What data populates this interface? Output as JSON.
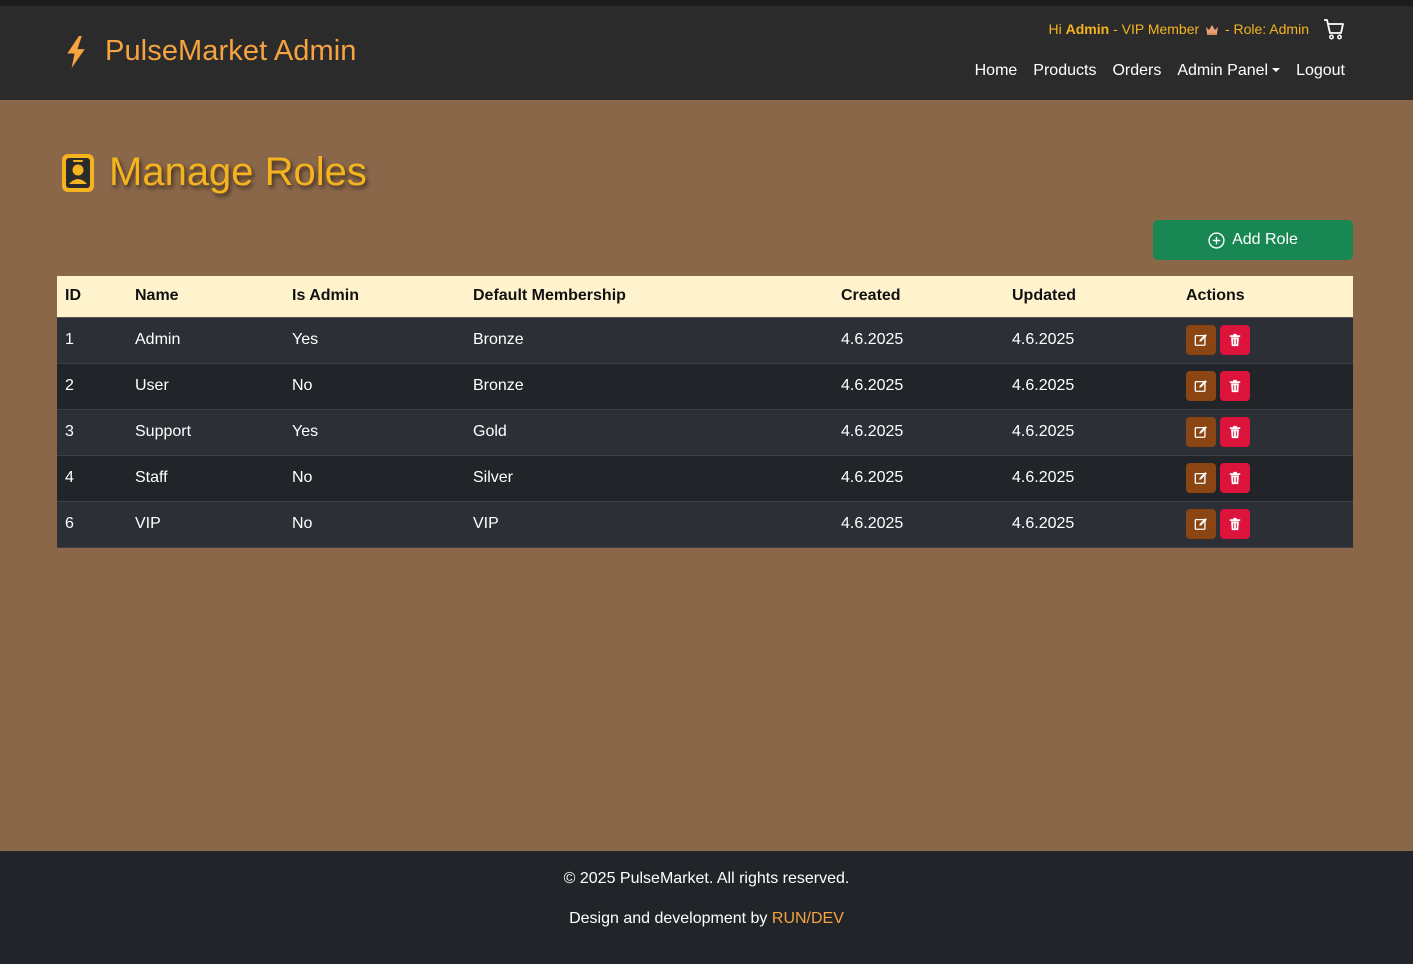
{
  "brand": {
    "name": "PulseMarket Admin"
  },
  "user": {
    "greeting": "Hi",
    "name": "Admin",
    "membership": "- VIP Member",
    "role": "- Role: Admin"
  },
  "nav": {
    "home": "Home",
    "products": "Products",
    "orders": "Orders",
    "admin_panel": "Admin Panel",
    "logout": "Logout"
  },
  "page": {
    "title": "Manage Roles",
    "add_button": "Add Role"
  },
  "table": {
    "headers": [
      "ID",
      "Name",
      "Is Admin",
      "Default Membership",
      "Created",
      "Updated",
      "Actions"
    ],
    "rows": [
      [
        "1",
        "Admin",
        "Yes",
        "Bronze",
        "4.6.2025",
        "4.6.2025"
      ],
      [
        "2",
        "User",
        "No",
        "Bronze",
        "4.6.2025",
        "4.6.2025"
      ],
      [
        "3",
        "Support",
        "Yes",
        "Gold",
        "4.6.2025",
        "4.6.2025"
      ],
      [
        "4",
        "Staff",
        "No",
        "Silver",
        "4.6.2025",
        "4.6.2025"
      ],
      [
        "6",
        "VIP",
        "No",
        "VIP",
        "4.6.2025",
        "4.6.2025"
      ]
    ]
  },
  "footer": {
    "copyright": "© 2025 PulseMarket. All rights reserved.",
    "credit_prefix": "Design and development by",
    "credit_link": "RUN/DEV"
  },
  "colors": {
    "page_bg": "#8a6749",
    "navbar_bg": "#2b2b2b",
    "brand": "#f6a340",
    "title": "#f5b41f",
    "add_button": "#198754",
    "edit_button": "#8b4513",
    "delete_button": "#dc143c",
    "table_header": "#fff3cd"
  },
  "icons": {
    "brand": "bolt-icon",
    "cart": "cart-icon",
    "crown": "crown-icon",
    "title": "person-badge-icon",
    "add": "plus-circle-icon",
    "edit": "pencil-square-icon",
    "delete": "trash-icon"
  }
}
